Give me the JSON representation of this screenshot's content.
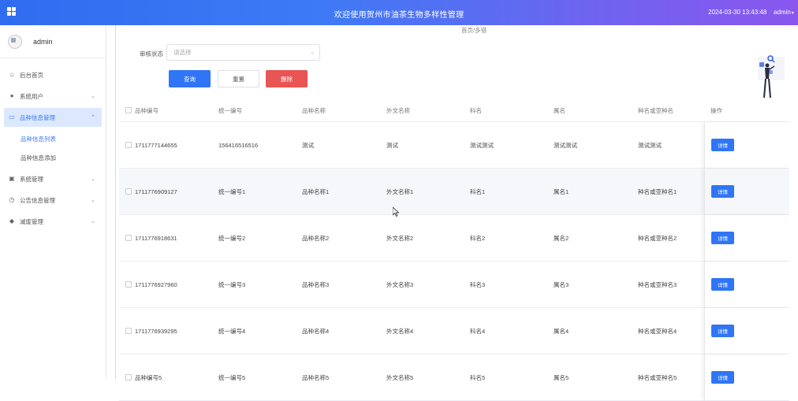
{
  "header": {
    "title": "欢迎使用贺州市油茶生物多样性管理",
    "datetime": "2024-03-30 13:43:48",
    "user": "admin",
    "colors": {
      "gradient_start": "#2f6cf0",
      "gradient_end": "#8a56ee"
    }
  },
  "sidebar": {
    "username": "admin",
    "items": [
      {
        "label": "后台首页",
        "icon": "home-icon"
      },
      {
        "label": "系统用户",
        "icon": "user-icon"
      },
      {
        "label": "品种信息管理",
        "icon": "folder-icon"
      },
      {
        "label": "系统管理",
        "icon": "chart-icon"
      },
      {
        "label": "公告信息管理",
        "icon": "clock-icon"
      },
      {
        "label": "减废管理",
        "icon": "leaf-icon"
      }
    ],
    "subitems": [
      {
        "label": "品种信息列表"
      },
      {
        "label": "品种信息添加"
      }
    ]
  },
  "breadcrumb": "首页/多错",
  "filter": {
    "label": "审核状态",
    "placeholder": "请选择"
  },
  "buttons": {
    "search": "查询",
    "reset": "重置",
    "delete": "删除"
  },
  "table": {
    "columns": [
      "品种编号",
      "统一编号",
      "品种名称",
      "外文名称",
      "科名",
      "属名",
      "种名或亚种名",
      "操作"
    ],
    "rows": [
      [
        "1711777144655",
        "156416516516",
        "测试",
        "测试",
        "测试测试",
        "测试测试",
        "测试测试"
      ],
      [
        "1711776909127",
        "统一编号1",
        "品种名称1",
        "外文名称1",
        "科名1",
        "属名1",
        "种名或亚种名1"
      ],
      [
        "1711776918631",
        "统一编号2",
        "品种名称2",
        "外文名称2",
        "科名2",
        "属名2",
        "种名或亚种名2"
      ],
      [
        "1711776927960",
        "统一编号3",
        "品种名称3",
        "外文名称3",
        "科名3",
        "属名3",
        "种名或亚种名3"
      ],
      [
        "1711776939295",
        "统一编号4",
        "品种名称4",
        "外文名称4",
        "科名4",
        "属名4",
        "种名或亚种名4"
      ],
      [
        "品种编号5",
        "统一编号5",
        "品种名称5",
        "外文名称5",
        "科名5",
        "属名5",
        "种名或亚种名5"
      ]
    ],
    "action_label": "详情"
  }
}
